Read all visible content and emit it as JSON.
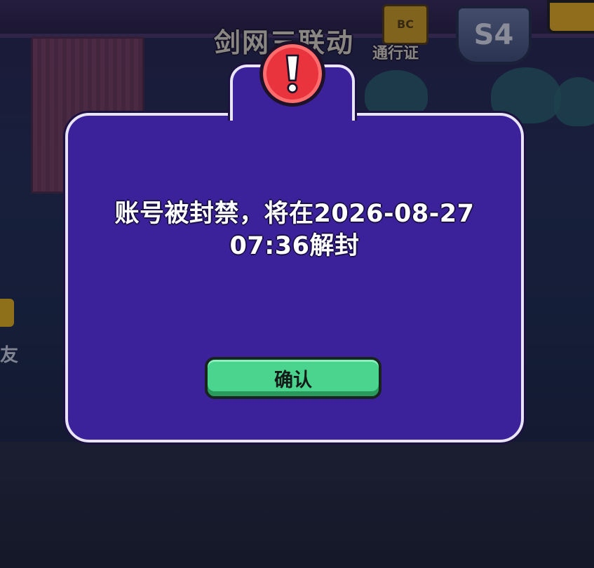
{
  "top_bar": {
    "event_title": "剑网三联动",
    "pass_label": "通行证",
    "pass_badge": "BC",
    "season_label": "S4"
  },
  "left_edge": {
    "friend_label": "友"
  },
  "dialog": {
    "alert_icon": "exclamation-icon",
    "message_line1": "账号被封禁，将在2026-08-27",
    "message_line2": "07:36解封",
    "confirm_label": "确认"
  },
  "colors": {
    "dialog_bg": "#3b229a",
    "dialog_border": "#e9e4f6",
    "alert_red": "#e9333d",
    "confirm_green": "#4ad48e"
  }
}
